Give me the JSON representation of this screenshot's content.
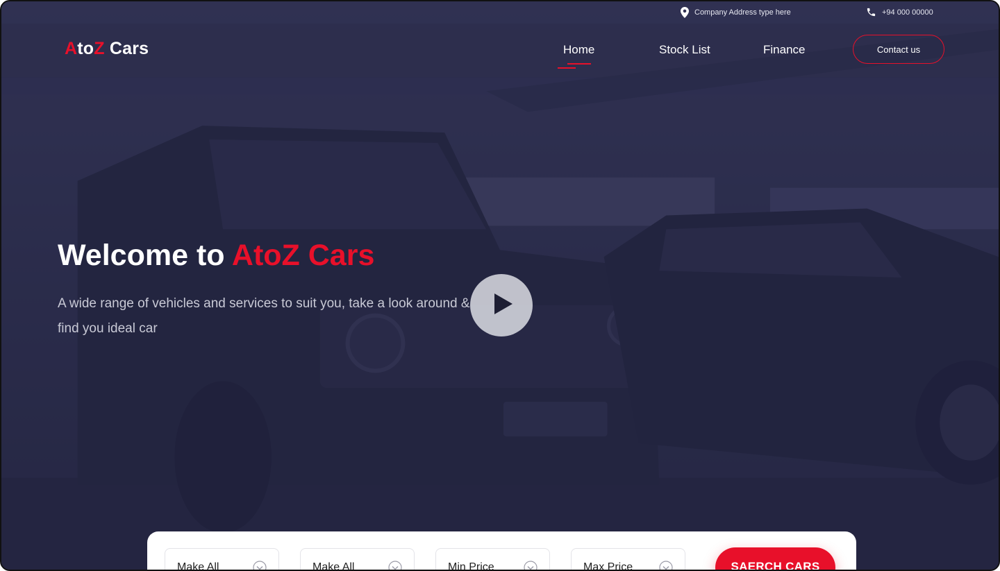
{
  "topbar": {
    "address": "Company Address type here",
    "phone": "+94 000 00000"
  },
  "brand": {
    "part1": "A",
    "part2": "to",
    "part3": "Z",
    "part4": " Cars"
  },
  "nav": {
    "items": [
      {
        "label": "Home",
        "active": true
      },
      {
        "label": "Stock List",
        "active": false
      },
      {
        "label": "Finance",
        "active": false
      }
    ],
    "contact_label": "Contact us"
  },
  "hero": {
    "title_white": "Welcome to ",
    "title_red": "AtoZ Cars",
    "subtitle": "A wide range of vehicles and services to suit you, take a look around & find you ideal car"
  },
  "search": {
    "filters": [
      {
        "value": "Make All"
      },
      {
        "value": "Make All"
      },
      {
        "value": "Min Price"
      },
      {
        "value": "Max Price"
      }
    ],
    "button_label": "SAERCH CARS"
  },
  "colors": {
    "accent": "#e8102a",
    "hero_overlay": "#2b2c48",
    "white": "#ffffff"
  },
  "icons": {
    "address": "map-pin-icon",
    "phone": "phone-icon",
    "play": "play-icon",
    "dropdown": "chevron-down-icon"
  }
}
